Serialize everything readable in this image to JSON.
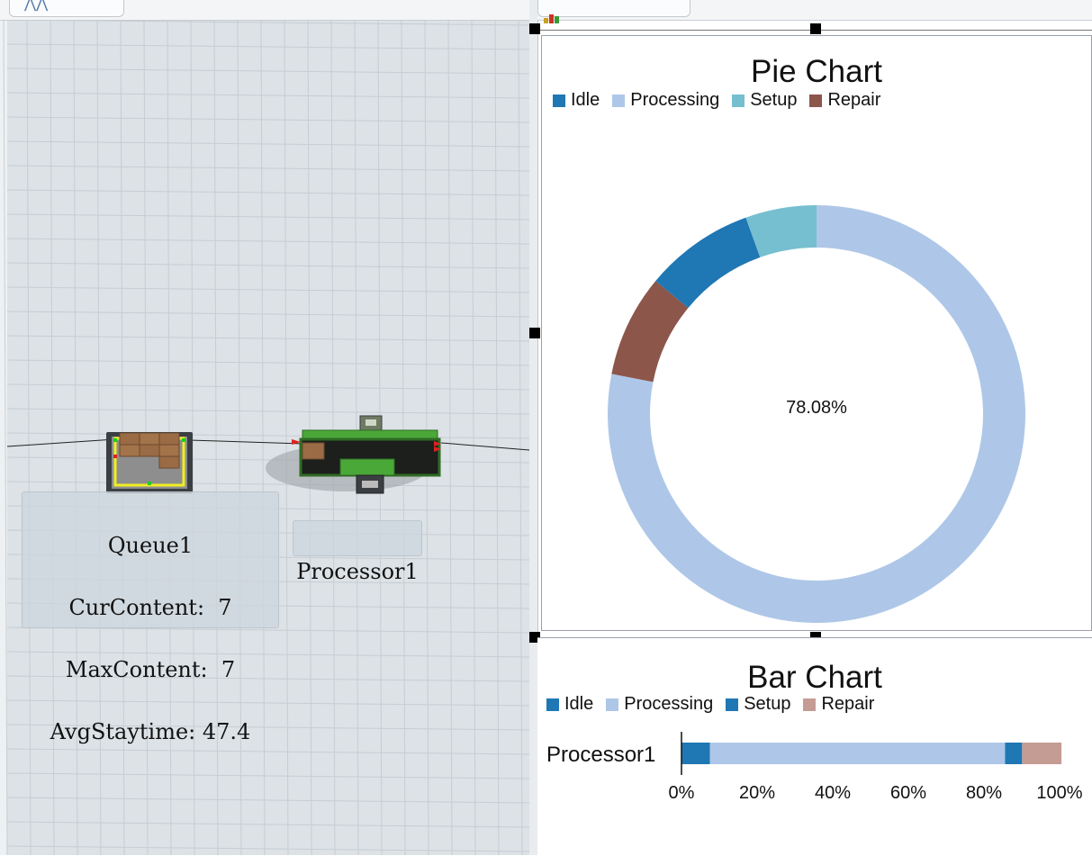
{
  "view3d": {
    "queue": {
      "name": "Queue1",
      "cur_content": "CurContent:  7",
      "max_content": "MaxContent:  7",
      "avg_staytime": "AvgStaytime: 47.4"
    },
    "processor": {
      "name": "Processor1"
    }
  },
  "colors": {
    "idle": "#1f77b4",
    "processing": "#aec7e8",
    "setup": "#76bfd0",
    "repair": "#8c564b",
    "repair_bar": "#c49c94"
  },
  "pie_chart": {
    "title": "Pie Chart",
    "legend": [
      "Idle",
      "Processing",
      "Setup",
      "Repair"
    ],
    "center_label": "78.08%"
  },
  "bar_chart": {
    "title": "Bar Chart",
    "legend": [
      "Idle",
      "Processing",
      "Setup",
      "Repair"
    ],
    "category_label": "Processor1",
    "ticks": [
      "0%",
      "20%",
      "40%",
      "60%",
      "80%",
      "100%"
    ]
  },
  "chart_data": [
    {
      "type": "pie",
      "title": "Pie Chart",
      "labels": [
        "Idle",
        "Processing",
        "Setup",
        "Repair"
      ],
      "values": [
        8.5,
        78.08,
        5.5,
        7.92
      ],
      "center_text": "78.08%",
      "legend": "top-left"
    },
    {
      "type": "bar",
      "title": "Bar Chart",
      "orientation": "horizontal-stacked",
      "categories": [
        "Processor1"
      ],
      "series": [
        {
          "name": "Idle",
          "values": [
            7.5
          ]
        },
        {
          "name": "Processing",
          "values": [
            78.08
          ]
        },
        {
          "name": "Setup",
          "values": [
            4.5
          ]
        },
        {
          "name": "Repair",
          "values": [
            10.42
          ]
        }
      ],
      "xlim": [
        0,
        100
      ],
      "legend": "top-left"
    }
  ]
}
